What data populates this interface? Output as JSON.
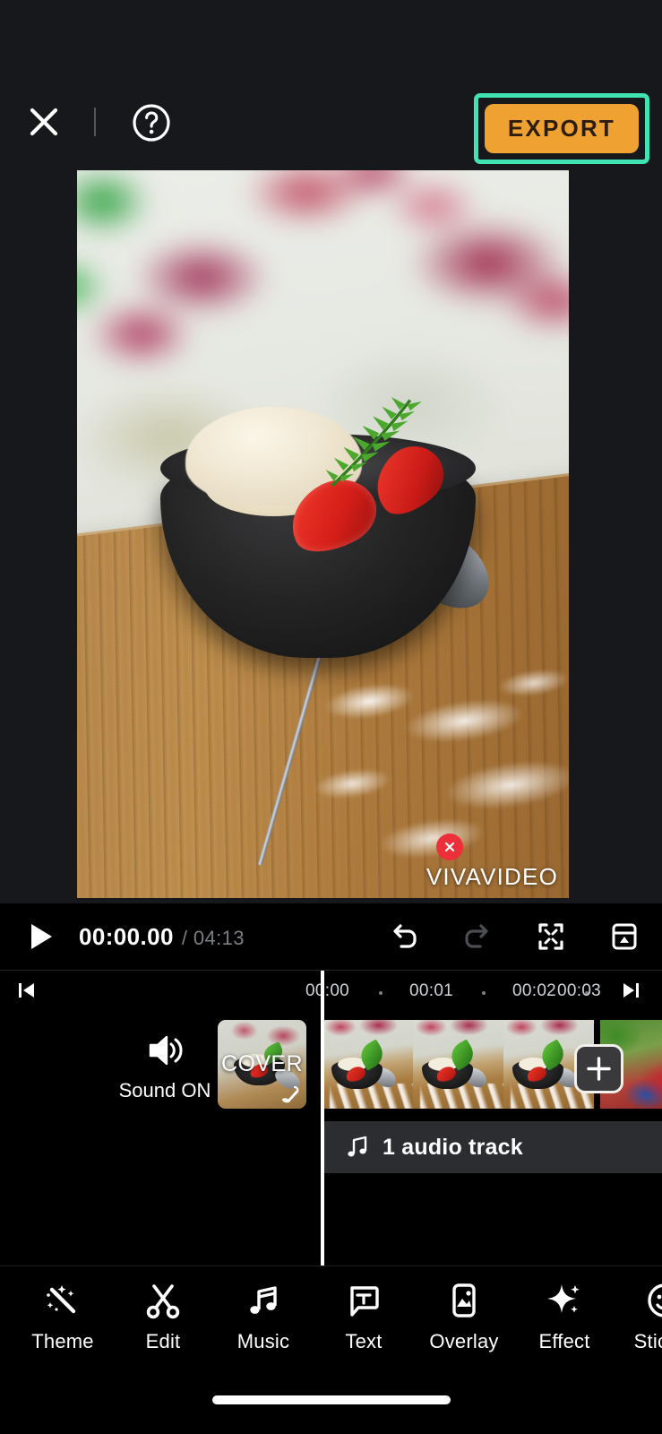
{
  "app": {
    "name": "VivaVideo Editor",
    "theme_bg": "#16181b",
    "timeline_bg": "#000000",
    "accent_orange": "#efa231",
    "highlight_teal": "#3fe3b4",
    "watermark_red": "#ed2f3a"
  },
  "topbar": {
    "close_icon": "close-icon",
    "help_icon": "question-mark-circle-icon",
    "export_label": "EXPORT"
  },
  "preview": {
    "watermark_text": "VIVAVIDEO",
    "watermark_close_icon": "close-circle-icon",
    "scene_description": "Black bowl of vanilla ice cream with strawberry slices and fern leaf on a wooden board with spoon and powdered sugar"
  },
  "playback": {
    "play_icon": "play-icon",
    "current_time": "00:00.00",
    "total_time": "/ 04:13",
    "undo_icon": "undo-icon",
    "redo_icon": "redo-icon",
    "fullscreen_icon": "fullscreen-expand-icon",
    "save_icon": "save-project-icon"
  },
  "timeline": {
    "skip_start_icon": "skip-to-start-icon",
    "skip_end_icon": "skip-to-end-icon",
    "ticks": [
      "00:00",
      "00:01",
      "00:02",
      "00:03"
    ],
    "sound_icon": "speaker-volume-icon",
    "sound_label": "Sound ON",
    "cover_label": "COVER",
    "cover_edit_icon": "pencil-edit-icon",
    "add_clip_icon": "plus-icon",
    "audio_icon": "music-note-icon",
    "audio_label": "1 audio track"
  },
  "toolbar": {
    "items": [
      {
        "label": "Theme",
        "icon": "magic-wand-icon"
      },
      {
        "label": "Edit",
        "icon": "scissors-icon"
      },
      {
        "label": "Music",
        "icon": "music-note-icon"
      },
      {
        "label": "Text",
        "icon": "text-bubble-icon"
      },
      {
        "label": "Overlay",
        "icon": "image-frame-icon"
      },
      {
        "label": "Effect",
        "icon": "sparkle-icon"
      },
      {
        "label": "Sticker",
        "icon": "smiley-sticker-icon"
      }
    ]
  }
}
